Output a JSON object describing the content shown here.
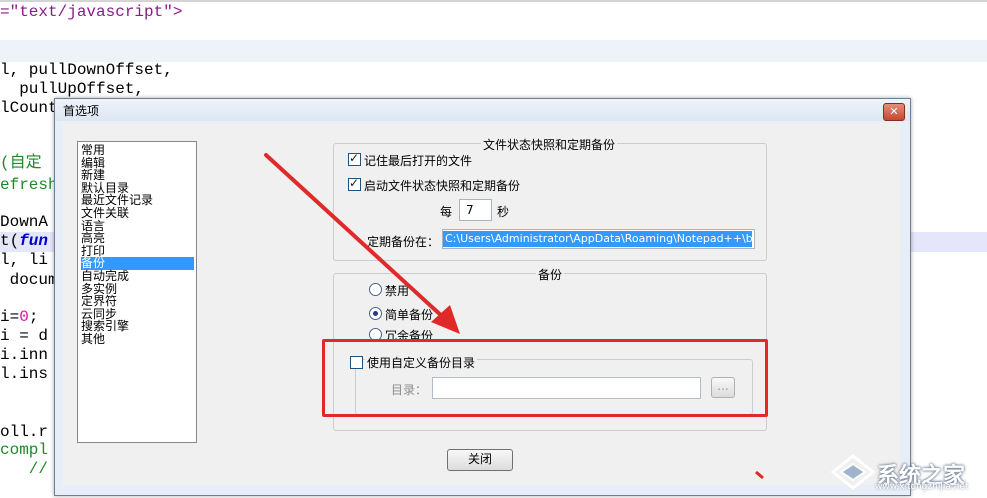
{
  "editor": {
    "lines": [
      {
        "parts": [
          {
            "t": "=\"text/javascript\">",
            "c": "str"
          }
        ]
      },
      {
        "parts": [
          {
            "t": "l, pullDownOffset,",
            "c": "plain"
          }
        ]
      },
      {
        "parts": [
          {
            "t": "  pullUpOffset,",
            "c": "plain"
          }
        ]
      },
      {
        "parts": [
          {
            "t": "lCount",
            "c": "plain"
          }
        ]
      },
      {
        "parts": [
          {
            "t": "(自定",
            "c": "cmt"
          }
        ]
      },
      {
        "parts": [
          {
            "t": "efresh",
            "c": "cmt"
          }
        ]
      },
      {
        "parts": [
          {
            "t": "DownA",
            "c": "plain"
          }
        ]
      },
      {
        "parts": [
          {
            "t": "t(",
            "c": "plain"
          },
          {
            "t": "fun",
            "c": "kw"
          }
        ]
      },
      {
        "parts": [
          {
            "t": "l, li",
            "c": "plain"
          }
        ]
      },
      {
        "parts": [
          {
            "t": " docum",
            "c": "plain"
          }
        ]
      },
      {
        "parts": [
          {
            "t": "i=",
            "c": "plain"
          },
          {
            "t": "0",
            "c": "num"
          },
          {
            "t": "; ",
            "c": "plain"
          }
        ]
      },
      {
        "parts": [
          {
            "t": "i = d",
            "c": "plain"
          }
        ]
      },
      {
        "parts": [
          {
            "t": "i.inn",
            "c": "plain"
          }
        ]
      },
      {
        "parts": [
          {
            "t": "l.ins",
            "c": "plain"
          }
        ]
      },
      {
        "parts": [
          {
            "t": "oll.r",
            "c": "plain"
          }
        ]
      },
      {
        "parts": [
          {
            "t": "compl",
            "c": "cmt"
          }
        ]
      },
      {
        "parts": [
          {
            "t": "   //",
            "c": "cmt"
          }
        ]
      }
    ]
  },
  "dialog": {
    "title": "首选项",
    "close_glyph": "✕",
    "categories": [
      "常用",
      "编辑",
      "新建",
      "默认目录",
      "最近文件记录",
      "文件关联",
      "语言",
      "高亮",
      "打印",
      "备份",
      "自动完成",
      "多实例",
      "定界符",
      "云同步",
      "搜索引擎",
      "其他"
    ],
    "selected_category": "备份",
    "snapshot_group": {
      "title": "文件状态快照和定期备份",
      "remember_last_files": {
        "label": "记住最后打开的文件",
        "checked": true
      },
      "enable_snapshot": {
        "label": "启动文件状态快照和定期备份",
        "checked": true
      },
      "every_label": "每",
      "interval_value": "7",
      "seconds_label": "秒",
      "backup_path_label": "定期备份在：",
      "backup_path_value": "C:\\Users\\Administrator\\AppData\\Roaming\\Notepad++\\backup\\"
    },
    "backup_group": {
      "title": "备份",
      "options": [
        {
          "label": "禁用",
          "selected": false
        },
        {
          "label": "简单备份",
          "selected": true
        },
        {
          "label": "冗余备份",
          "selected": false
        }
      ],
      "custom_dir": {
        "label": "使用自定义备份目录",
        "checked": false
      },
      "dir_label": "目录：",
      "dir_value": "",
      "browse_label": "..."
    },
    "close_button": "关闭"
  },
  "annotation": {
    "color": "#e02a2a"
  },
  "watermark": {
    "text": "系统之家",
    "url": "www.xitongzhijia.net"
  }
}
